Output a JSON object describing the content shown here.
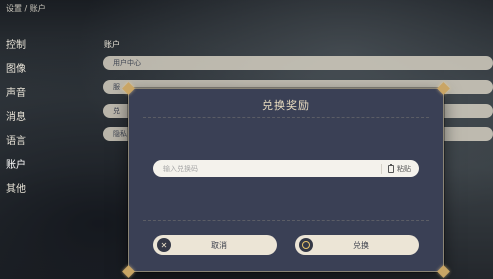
{
  "breadcrumb": "设置 / 账户",
  "sidebar": {
    "items": [
      {
        "label": "控制"
      },
      {
        "label": "图像"
      },
      {
        "label": "声音"
      },
      {
        "label": "消息"
      },
      {
        "label": "语言"
      },
      {
        "label": "账户"
      },
      {
        "label": "其他"
      }
    ],
    "active_index": 5
  },
  "section": {
    "title": "账户",
    "rows": [
      {
        "label": "用户中心"
      },
      {
        "label": "服"
      },
      {
        "label": "兑"
      },
      {
        "label": "隐私"
      }
    ]
  },
  "dialog": {
    "title": "兑换奖励",
    "input": {
      "value": "",
      "placeholder": "输入兑换码"
    },
    "paste_label": "粘贴",
    "cancel_label": "取消",
    "confirm_label": "兑换",
    "cancel_icon": "close-icon",
    "confirm_icon": "confirm-circle-icon"
  },
  "colors": {
    "dialog_bg": "#3a4055",
    "accent_gold": "#c9a565",
    "button_bg": "#ece5d6"
  }
}
